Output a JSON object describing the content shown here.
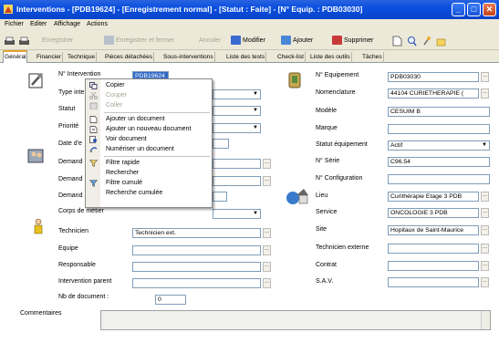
{
  "window": {
    "title": "Interventions - [PDB19624] - [Enregistrement normal] - [Statut : Faite] - [N° Equip. : PDB03030]",
    "minimize": "_",
    "maximize": "□",
    "close": "✕"
  },
  "menu": {
    "items": [
      "Fichier",
      "Editer",
      "Affichage",
      "Actions"
    ]
  },
  "toolbar": {
    "enregistrer": "Enregistrer",
    "enregistrer_fermer": "Enregistrer et fermer",
    "annuler": "Annuler",
    "modifier": "Modifier",
    "ajouter": "Ajouter",
    "supprimer": "Supprimer"
  },
  "tabs": [
    "Général",
    "Financier",
    "Technique",
    "Pièces détachées",
    "Sous-interventions",
    "Liste des tests",
    "Check-list",
    "Liste des outils",
    "Tâches"
  ],
  "left": {
    "n_intervention_label": "N° Intervention",
    "n_intervention_value": "PDB19624",
    "type_label": "Type inte",
    "statut_label": "Statut",
    "priorite_label": "Priorité",
    "date_label": "Date d'e",
    "demandeur1_label": "Demand",
    "demandeur2_label": "Demand",
    "demandeur3_label": "Demand",
    "corps_label": "Corps de métier",
    "technicien_label": "Technicien",
    "technicien_value": "Technicien ext.",
    "equipe_label": "Equipe",
    "responsable_label": "Responsable",
    "intervention_parent_label": "Intervention parent",
    "nb_document_label": "Nb de document :",
    "nb_document_value": "0",
    "commentaires_label": "Commentaires"
  },
  "right": {
    "n_equipement_label": "N° Equipement",
    "n_equipement_value": "PDB03030",
    "nomenclature_label": "Nomenclature",
    "nomenclature_value": "44104 CURIETHERAPIE (",
    "modele_label": "Modèle",
    "modele_value": "CESUIM B",
    "marque_label": "Marque",
    "marque_value": "",
    "statut_equipement_label": "Statut équipement",
    "statut_equipement_value": "Actif",
    "n_serie_label": "N° Série",
    "n_serie_value": "C96.54",
    "n_configuration_label": "N° Configuration",
    "n_configuration_value": "",
    "lieu_label": "Lieu",
    "lieu_value": "Curithérapie Etage 3 PDB",
    "service_label": "Service",
    "service_value": "ONCOLOGIE 3 PDB",
    "site_label": "Site",
    "site_value": "Hopitaux de Saint-Maurice",
    "technicien_externe_label": "Technicien externe",
    "contrat_label": "Contrat",
    "sav_label": "S.A.V."
  },
  "context_menu": {
    "copier": "Copier",
    "couper": "Couper",
    "coller": "Coller",
    "ajouter_document": "Ajouter un document",
    "ajouter_nouveau_document": "Ajouter un nouveau document",
    "voir_document": "Voir document",
    "numeriser_document": "Numériser un document",
    "filtre_rapide": "Filtre rapide",
    "rechercher": "Rechercher",
    "filtre_cumule": "Filtre cumulé",
    "recherche_cumulee": "Recherche cumulée"
  },
  "colors": {
    "titlebar": "#0a4fe0",
    "selection": "#316ac5",
    "tab_active_accent": "#e6a42e"
  },
  "icons": {
    "dropdown": "▼",
    "ellipsis": "..."
  }
}
